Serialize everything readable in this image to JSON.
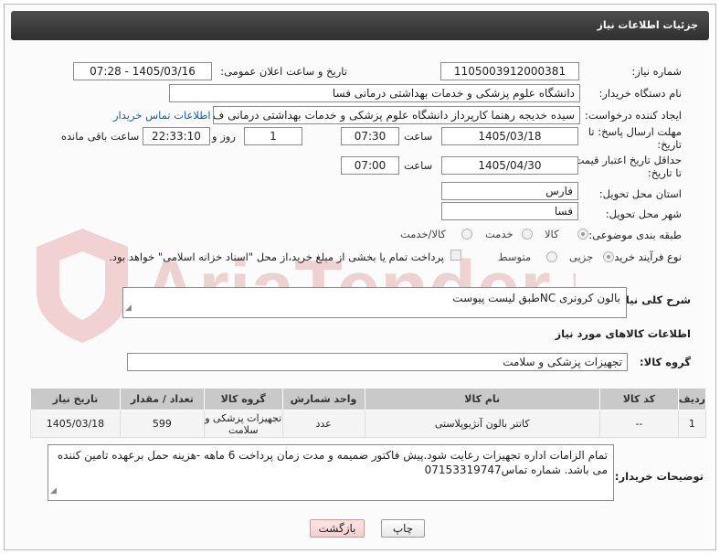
{
  "header": {
    "title": "جزئیات اطلاعات نیاز"
  },
  "fields": {
    "need_number": {
      "label": "شماره نیاز:",
      "value": "1105003912000381"
    },
    "announce": {
      "label": "تاریخ و ساعت اعلان عمومی:",
      "value": "1405/03/16 - 07:28"
    },
    "buyer_org": {
      "label": "نام دستگاه خریدار:",
      "value": "دانشگاه علوم پزشکی و خدمات بهداشتی درمانی فسا"
    },
    "creator": {
      "label": "ایجاد کننده درخواست:",
      "value": "سیده خدیجه رهنما کارپرداز دانشگاه علوم پزشکی و خدمات بهداشتی درمانی ف",
      "contact_link": "اطلاعات تماس خریدار"
    },
    "deadline": {
      "label_line1": "مهلت ارسال پاسخ: تا",
      "label_line2": "تاریخ:",
      "date": "1405/03/18",
      "time_label": "ساعت",
      "time": "07:30",
      "days": "1",
      "days_label": "روز و",
      "remaining": "22:33:10",
      "remaining_label": "ساعت باقی مانده"
    },
    "validity": {
      "label_line1": "حداقل تاریخ اعتبار قیمت:",
      "label_line2": "تا تاریخ:",
      "date": "1405/04/30",
      "time_label": "ساعت",
      "time": "07:00"
    },
    "province": {
      "label": "استان محل تحویل:",
      "value": "فارس"
    },
    "city": {
      "label": "شهر محل تحویل:",
      "value": "فسا"
    },
    "category": {
      "label": "طبقه بندی موضوعی:",
      "options": [
        "کالا",
        "خدمت",
        "کالا/خدمت"
      ],
      "selected": "کالا"
    },
    "process": {
      "label": "نوع فرآیند خرید :",
      "options": [
        "جزیی",
        "متوسط"
      ],
      "selected": "جزیی",
      "payment_note": "پرداخت تمام یا بخشی از مبلغ خرید،از محل \"اسناد خزانه اسلامی\" خواهد بود."
    }
  },
  "description": {
    "label": "شرح کلی نیاز:",
    "value": "بالون کرونری NCطبق لیست پیوست"
  },
  "goods_section": {
    "title": "اطلاعات کالاهای مورد نیاز",
    "group_label": "گروه کالا:",
    "group_value": "تجهیزات پزشکی و سلامت"
  },
  "table": {
    "headers": [
      "ردیف",
      "کد کالا",
      "نام کالا",
      "واحد شمارش",
      "گروه کالا",
      "تعداد / مقدار",
      "تاریخ نیاز"
    ],
    "rows": [
      [
        "1",
        "--",
        "کاتتر بالون آنژیوپلاستی",
        "عدد",
        "تجهیزات پزشکی و سلامت",
        "599",
        "1405/03/18"
      ]
    ]
  },
  "buyer_notes": {
    "label": "توضیحات خریدار:",
    "value": "تمام الزامات اداره تجهیزات رعایت شود.پیش فاکتور ضمیمه و مدت زمان پرداخت 6 ماهه -هزینه  حمل برعهده تامین کننده می باشد. شماره تماس07153319747"
  },
  "buttons": {
    "print": "چاپ",
    "back": "بازگشت"
  },
  "watermark": {
    "text": "AriaTender.net"
  },
  "colors": {
    "header_bg": "#3c3c3c",
    "link": "#1a5ab8",
    "table_header": "#c9c9c9",
    "back_button": "#f4cccc"
  }
}
